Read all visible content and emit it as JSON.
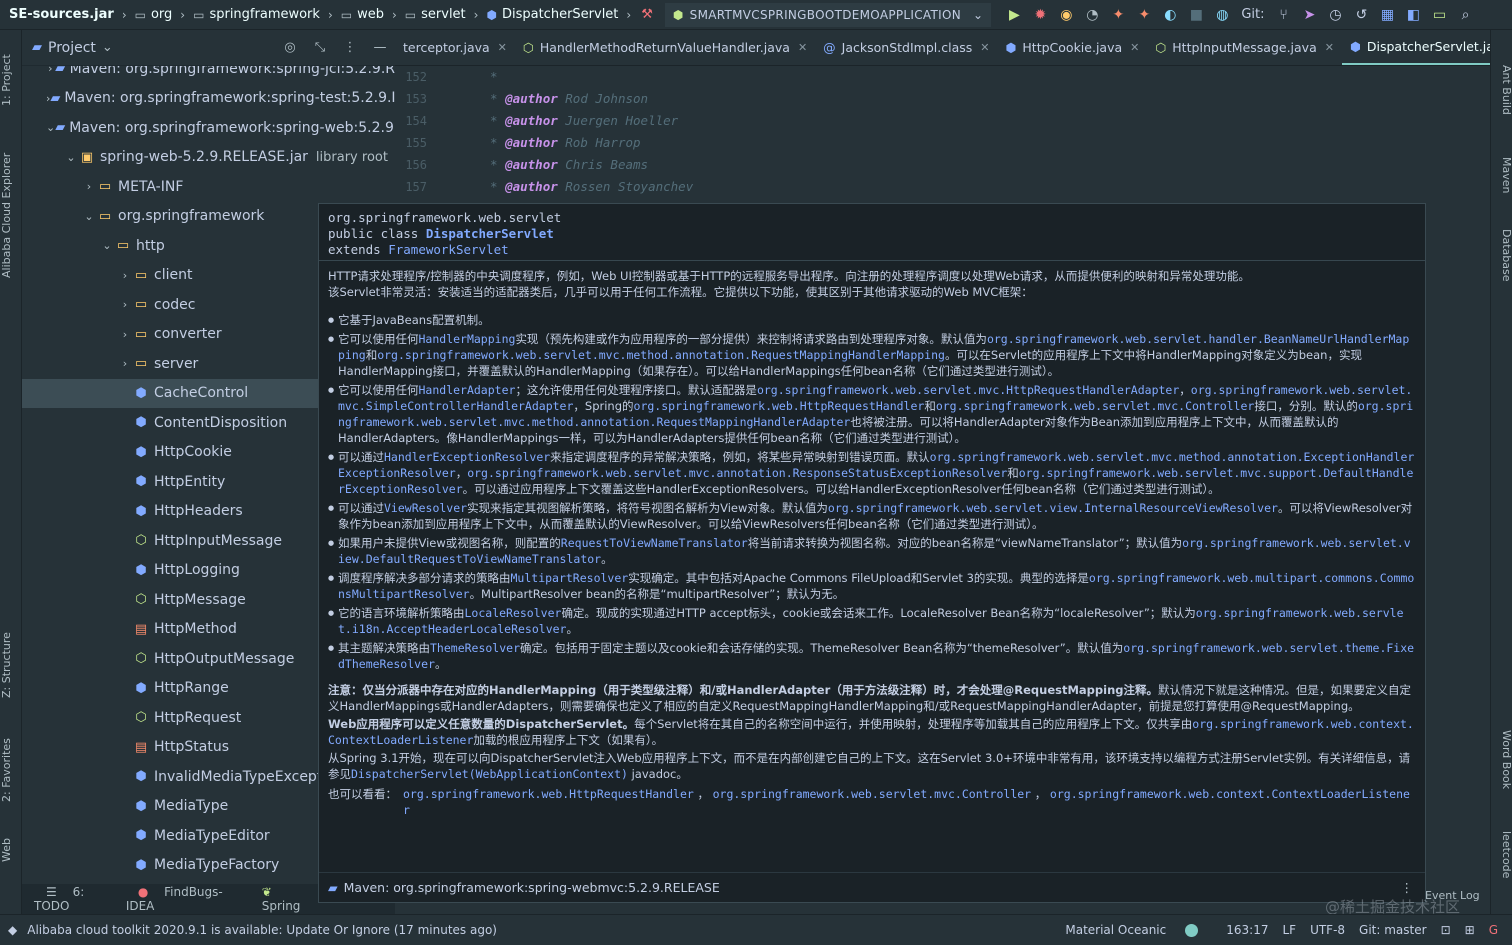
{
  "breadcrumb": [
    {
      "label": "SE-sources.jar",
      "icon": "jar-icon"
    },
    {
      "label": "org",
      "icon": "package-icon"
    },
    {
      "label": "springframework",
      "icon": "package-icon"
    },
    {
      "label": "web",
      "icon": "package-icon"
    },
    {
      "label": "servlet",
      "icon": "package-icon"
    },
    {
      "label": "DispatcherServlet",
      "icon": "class-icon"
    }
  ],
  "run_config": "SMARTMVCSPRINGBOOTDEMOAPPLICATION",
  "toolbar": {
    "git_label": "Git:"
  },
  "left_strip": {
    "project": "1: Project",
    "alibaba": "Alibaba Cloud Explorer",
    "structure": "Z: Structure",
    "favorites": "2: Favorites",
    "web": "Web"
  },
  "right_strip": {
    "ant": "Ant Build",
    "maven": "Maven",
    "database": "Database",
    "wordbook": "Word Book",
    "leetcode": "leetcode"
  },
  "project_panel": {
    "title": "Project",
    "tree": [
      {
        "label": "Maven: org.springframework:spring-jcl:5.2.9.R",
        "kind": "lib",
        "indent": 0,
        "arrow": "›"
      },
      {
        "label": "Maven: org.springframework:spring-test:5.2.9.I",
        "kind": "lib",
        "indent": 0,
        "arrow": "›"
      },
      {
        "label": "Maven: org.springframework:spring-web:5.2.9.I",
        "kind": "lib",
        "indent": 0,
        "arrow": "⌄"
      },
      {
        "label": "spring-web-5.2.9.RELEASE.jar",
        "suffix": "library root",
        "kind": "jar",
        "indent": 1,
        "arrow": "⌄"
      },
      {
        "label": "META-INF",
        "kind": "folder",
        "indent": 2,
        "arrow": "›"
      },
      {
        "label": "org.springframework",
        "kind": "folder",
        "indent": 2,
        "arrow": "⌄"
      },
      {
        "label": "http",
        "kind": "folder",
        "indent": 3,
        "arrow": "⌄"
      },
      {
        "label": "client",
        "kind": "folder",
        "indent": 4,
        "arrow": "›"
      },
      {
        "label": "codec",
        "kind": "folder",
        "indent": 4,
        "arrow": "›"
      },
      {
        "label": "converter",
        "kind": "folder",
        "indent": 4,
        "arrow": "›"
      },
      {
        "label": "server",
        "kind": "folder",
        "indent": 4,
        "arrow": "›"
      },
      {
        "label": "CacheControl",
        "kind": "class",
        "indent": 4,
        "arrow": "",
        "selected": true
      },
      {
        "label": "ContentDisposition",
        "kind": "class",
        "indent": 4,
        "arrow": ""
      },
      {
        "label": "HttpCookie",
        "kind": "class",
        "indent": 4,
        "arrow": ""
      },
      {
        "label": "HttpEntity",
        "kind": "class",
        "indent": 4,
        "arrow": ""
      },
      {
        "label": "HttpHeaders",
        "kind": "class",
        "indent": 4,
        "arrow": ""
      },
      {
        "label": "HttpInputMessage",
        "kind": "interface",
        "indent": 4,
        "arrow": ""
      },
      {
        "label": "HttpLogging",
        "kind": "class",
        "indent": 4,
        "arrow": ""
      },
      {
        "label": "HttpMessage",
        "kind": "interface",
        "indent": 4,
        "arrow": ""
      },
      {
        "label": "HttpMethod",
        "kind": "enum",
        "indent": 4,
        "arrow": ""
      },
      {
        "label": "HttpOutputMessage",
        "kind": "interface",
        "indent": 4,
        "arrow": ""
      },
      {
        "label": "HttpRange",
        "kind": "class",
        "indent": 4,
        "arrow": ""
      },
      {
        "label": "HttpRequest",
        "kind": "interface",
        "indent": 4,
        "arrow": ""
      },
      {
        "label": "HttpStatus",
        "kind": "enum",
        "indent": 4,
        "arrow": ""
      },
      {
        "label": "InvalidMediaTypeExcepti",
        "kind": "class",
        "indent": 4,
        "arrow": ""
      },
      {
        "label": "MediaType",
        "kind": "class",
        "indent": 4,
        "arrow": ""
      },
      {
        "label": "MediaTypeEditor",
        "kind": "class",
        "indent": 4,
        "arrow": ""
      },
      {
        "label": "MediaTypeFactory",
        "kind": "class",
        "indent": 4,
        "arrow": ""
      }
    ]
  },
  "tabs": [
    {
      "label": "terceptor.java",
      "icon": "java-icon"
    },
    {
      "label": "HandlerMethodReturnValueHandler.java",
      "icon": "interface-icon"
    },
    {
      "label": "JacksonStdImpl.class",
      "icon": "annotation-icon"
    },
    {
      "label": "HttpCookie.java",
      "icon": "class-icon"
    },
    {
      "label": "HttpInputMessage.java",
      "icon": "interface-icon"
    },
    {
      "label": "DispatcherServlet.java",
      "icon": "class-icon",
      "active": true
    }
  ],
  "tabs_overflow": "5",
  "editor": {
    "lines": [
      {
        "no": "152",
        "tag": "",
        "text": "*"
      },
      {
        "no": "153",
        "tag": "@author",
        "text": "Rod Johnson"
      },
      {
        "no": "154",
        "tag": "@author",
        "text": "Juergen Hoeller"
      },
      {
        "no": "155",
        "tag": "@author",
        "text": "Rob Harrop"
      },
      {
        "no": "156",
        "tag": "@author",
        "text": "Chris Beams"
      },
      {
        "no": "157",
        "tag": "@author",
        "text": "Rossen Stoyanchev"
      }
    ]
  },
  "popup": {
    "sig_package": "org.springframework.web.servlet",
    "sig_decl_prefix": "public class ",
    "sig_class": "DispatcherServlet",
    "sig_extends_prefix": "extends ",
    "sig_extends": "FrameworkServlet",
    "intro_1": "HTTP请求处理程序/控制器的中央调度程序，例如，Web UI控制器或基于HTTP的远程服务导出程序。向注册的处理程序调度以处理Web请求，从而提供便利的映射和异常处理功能。",
    "intro_2": "该Servlet非常灵活：安装适当的适配器类后，几乎可以用于任何工作流程。它提供以下功能，使其区别于其他请求驱动的Web MVC框架：",
    "b1": "它基于JavaBeans配置机制。",
    "b2_a": "它可以使用任何",
    "b2_l1": "HandlerMapping",
    "b2_b": "实现（预先构建或作为应用程序的一部分提供）来控制将请求路由到处理程序对象。默认值为",
    "b2_l2": "org.springframework.web.servlet.handler.BeanNameUrlHandlerMapping",
    "b2_c": "和",
    "b2_l3": "org.springframework.web.servlet.mvc.method.annotation.RequestMappingHandlerMapping",
    "b2_d": "。可以在Servlet的应用程序上下文中将HandlerMapping对象定义为bean，实现HandlerMapping接口，并覆盖默认的HandlerMapping（如果存在）。可以给HandlerMappings任何bean名称（它们通过类型进行测试）。",
    "b3_a": "它可以使用任何",
    "b3_l1": "HandlerAdapter",
    "b3_b": "；这允许使用任何处理程序接口。默认适配器是",
    "b3_l2": "org.springframework.web.servlet.mvc.HttpRequestHandlerAdapter",
    "b3_c": "，",
    "b3_l3": "org.springframework.web.servlet.mvc.SimpleControllerHandlerAdapter",
    "b3_d": "，Spring的",
    "b3_l4": "org.springframework.web.HttpRequestHandler",
    "b3_e": "和",
    "b3_l5": "org.springframework.web.servlet.mvc.Controller",
    "b3_f": "接口，分别。默认的",
    "b3_l6": "org.springframework.web.servlet.mvc.method.annotation.RequestMappingHandlerAdapter",
    "b3_g": "也将被注册。可以将HandlerAdapter对象作为Bean添加到应用程序上下文中，从而覆盖默认的HandlerAdapters。像HandlerMappings一样，可以为HandlerAdapters提供任何bean名称（它们通过类型进行测试）。",
    "b4_a": "可以通过",
    "b4_l1": "HandlerExceptionResolver",
    "b4_b": "来指定调度程序的异常解决策略，例如，将某些异常映射到错误页面。默认",
    "b4_l2": "org.springframework.web.servlet.mvc.method.annotation.ExceptionHandlerExceptionResolver",
    "b4_c": "，",
    "b4_l3": "org.springframework.web.servlet.mvc.annotation.ResponseStatusExceptionResolver",
    "b4_d": "和",
    "b4_l4": "org.springframework.web.servlet.mvc.support.DefaultHandlerExceptionResolver",
    "b4_e": "。可以通过应用程序上下文覆盖这些HandlerExceptionResolvers。可以给HandlerExceptionResolver任何bean名称（它们通过类型进行测试）。",
    "b5_a": "可以通过",
    "b5_l1": "ViewResolver",
    "b5_b": "实现来指定其视图解析策略，将符号视图名解析为View对象。默认值为",
    "b5_l2": "org.springframework.web.servlet.view.InternalResourceViewResolver",
    "b5_c": "。可以将ViewResolver对象作为bean添加到应用程序上下文中，从而覆盖默认的ViewResolver。可以给ViewResolvers任何bean名称（它们通过类型进行测试）。",
    "b6_a": "如果用户未提供View或视图名称，则配置的",
    "b6_l1": "RequestToViewNameTranslator",
    "b6_b": "将当前请求转换为视图名称。对应的bean名称是“viewNameTranslator”；默认值为",
    "b6_l2": "org.springframework.web.servlet.view.DefaultRequestToViewNameTranslator",
    "b6_c": "。",
    "b7_a": "调度程序解决多部分请求的策略由",
    "b7_l1": "MultipartResolver",
    "b7_b": "实现确定。其中包括对Apache Commons FileUpload和Servlet 3的实现。典型的选择是",
    "b7_l2": "org.springframework.web.multipart.commons.CommonsMultipartResolver",
    "b7_c": "。MultipartResolver bean的名称是“multipartResolver”；默认为无。",
    "b8_a": "它的语言环境解析策略由",
    "b8_l1": "LocaleResolver",
    "b8_b": "确定。现成的实现通过HTTP accept标头，cookie或会话来工作。LocaleResolver Bean名称为“localeResolver”；默认为",
    "b8_l2": "org.springframework.web.servlet.i18n.AcceptHeaderLocaleResolver",
    "b8_c": "。",
    "b9_a": "其主题解决策略由",
    "b9_l1": "ThemeResolver",
    "b9_b": "确定。包括用于固定主题以及cookie和会话存储的实现。ThemeResolver Bean名称为“themeResolver”。默认值为",
    "b9_l2": "org.springframework.web.servlet.theme.FixedThemeResolver",
    "b9_c": "。",
    "note_bold": "注意：仅当分派器中存在对应的HandlerMapping（用于类型级注释）和/或HandlerAdapter（用于方法级注释）时，才会处理@RequestMapping注释。",
    "note_rest": "默认情况下就是这种情况。但是，如果要定义自定义HandlerMappings或HandlerAdapters，则需要确保也定义了相应的自定义RequestMappingHandlerMapping和/或RequestMappingHandlerAdapter，前提是您打算使用@RequestMapping。",
    "multi_bold": "Web应用程序可以定义任意数量的DispatcherServlet。",
    "multi_rest": "每个Servlet将在其自己的名称空间中运行，并使用映射，处理程序等加载其自己的应用程序上下文。仅共享由",
    "multi_l1": "org.springframework.web.context.ContextLoaderListener",
    "multi_end": "加载的根应用程序上下文（如果有）。",
    "spring31_a": "从Spring 3.1开始，现在可以向DispatcherServlet注入Web应用程序上下文，而不是在内部创建它自己的上下文。这在Servlet 3.0+环境中非常有用，该环境支持以编程方式注册Servlet实例。有关详细信息，请参见",
    "spring31_l1": "DispatcherServlet(WebApplicationContext)",
    "spring31_b": " javadoc。",
    "see_also_label": "也可以看看：",
    "see_also_1": "org.springframework.web.HttpRequestHandler",
    "see_also_sep": " ， ",
    "see_also_2": "org.springframework.web.servlet.mvc.Controller",
    "see_also_3": "org.springframework.web.context.ContextLoaderListener",
    "footer": "Maven: org.springframework:spring-webmvc:5.2.9.RELEASE"
  },
  "bottom_tools": {
    "todo": "6: TODO",
    "findbugs": "FindBugs-IDEA",
    "spring": "Spring",
    "event_log": "Event Log"
  },
  "status": {
    "message": "Alibaba cloud toolkit 2020.9.1 is available: Update Or Ignore (17 minutes ago)",
    "theme": "Material Oceanic",
    "position": "163:17",
    "line_sep": "LF",
    "encoding": "UTF-8",
    "git": "Git: master"
  },
  "watermark": "@稀土掘金技术社区",
  "colors": {
    "accent": "#80cbc4",
    "link": "#82aaff",
    "folder": "#ffcb6b",
    "background": "#263238"
  }
}
